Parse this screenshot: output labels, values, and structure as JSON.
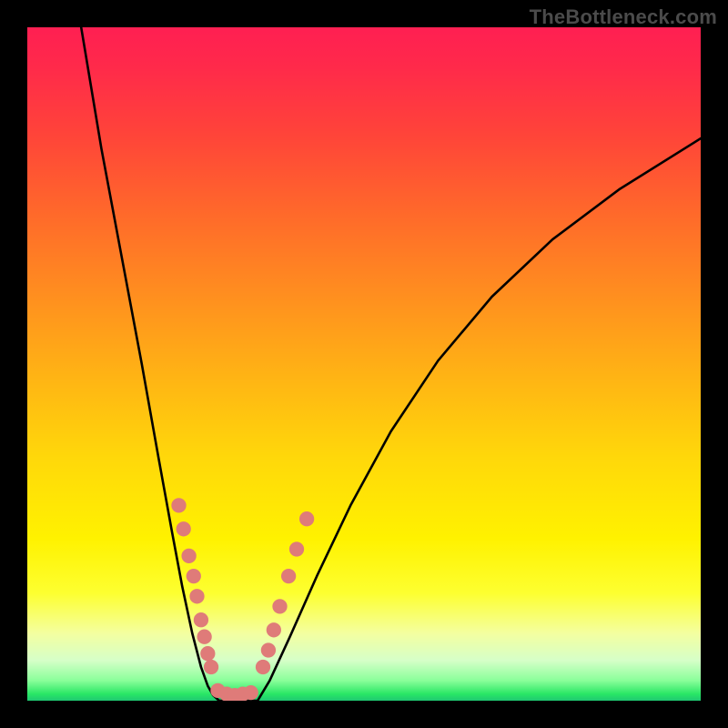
{
  "watermark": {
    "text": "TheBottleneck.com"
  },
  "chart_data": {
    "type": "line",
    "title": "",
    "xlabel": "",
    "ylabel": "",
    "xlim": [
      0,
      1
    ],
    "ylim": [
      0,
      1
    ],
    "legend": false,
    "grid": false,
    "gradient_stops": [
      {
        "pos": 0.0,
        "color": "#ff1f52"
      },
      {
        "pos": 0.16,
        "color": "#ff4439"
      },
      {
        "pos": 0.4,
        "color": "#ff8f1f"
      },
      {
        "pos": 0.64,
        "color": "#ffd80a"
      },
      {
        "pos": 0.84,
        "color": "#fdff30"
      },
      {
        "pos": 0.94,
        "color": "#d6ffc8"
      },
      {
        "pos": 1.0,
        "color": "#1fc873"
      }
    ],
    "series": [
      {
        "name": "left-branch",
        "x": [
          0.08,
          0.11,
          0.14,
          0.17,
          0.195,
          0.215,
          0.23,
          0.245,
          0.258,
          0.268,
          0.276,
          0.285
        ],
        "y": [
          1.0,
          0.82,
          0.66,
          0.5,
          0.36,
          0.25,
          0.17,
          0.1,
          0.05,
          0.022,
          0.008,
          0.0
        ]
      },
      {
        "name": "flat-bottom",
        "x": [
          0.285,
          0.3,
          0.315,
          0.33,
          0.342
        ],
        "y": [
          0.0,
          0.0,
          0.0,
          0.0,
          0.0
        ]
      },
      {
        "name": "right-branch",
        "x": [
          0.342,
          0.36,
          0.39,
          0.43,
          0.48,
          0.54,
          0.61,
          0.69,
          0.78,
          0.88,
          1.0
        ],
        "y": [
          0.0,
          0.03,
          0.095,
          0.185,
          0.29,
          0.4,
          0.505,
          0.6,
          0.685,
          0.76,
          0.835
        ]
      }
    ],
    "markers": {
      "color": "#df7b79",
      "radius_frac": 0.011,
      "left_cluster": [
        {
          "x": 0.225,
          "y": 0.29
        },
        {
          "x": 0.232,
          "y": 0.255
        },
        {
          "x": 0.24,
          "y": 0.215
        },
        {
          "x": 0.247,
          "y": 0.185
        },
        {
          "x": 0.252,
          "y": 0.155
        },
        {
          "x": 0.258,
          "y": 0.12
        },
        {
          "x": 0.263,
          "y": 0.095
        },
        {
          "x": 0.268,
          "y": 0.07
        },
        {
          "x": 0.273,
          "y": 0.05
        }
      ],
      "bottom_cluster": [
        {
          "x": 0.283,
          "y": 0.015
        },
        {
          "x": 0.296,
          "y": 0.01
        },
        {
          "x": 0.308,
          "y": 0.008
        },
        {
          "x": 0.32,
          "y": 0.01
        },
        {
          "x": 0.332,
          "y": 0.012
        }
      ],
      "right_cluster": [
        {
          "x": 0.35,
          "y": 0.05
        },
        {
          "x": 0.358,
          "y": 0.075
        },
        {
          "x": 0.366,
          "y": 0.105
        },
        {
          "x": 0.375,
          "y": 0.14
        },
        {
          "x": 0.388,
          "y": 0.185
        },
        {
          "x": 0.4,
          "y": 0.225
        },
        {
          "x": 0.415,
          "y": 0.27
        }
      ]
    }
  }
}
